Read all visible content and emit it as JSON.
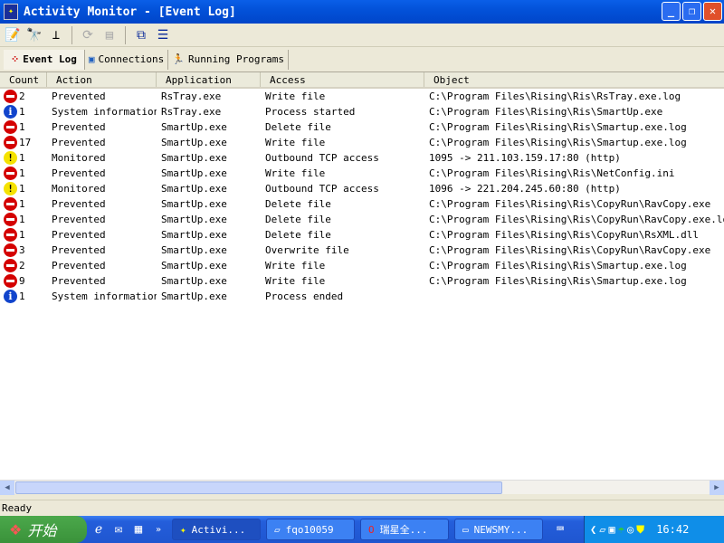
{
  "window": {
    "title": "Activity Monitor - [Event Log]"
  },
  "toolbar": [
    "properties-icon",
    "find-icon",
    "network-icon",
    "refresh-icon",
    "settings-icon",
    "cascade-icon",
    "tile-icon"
  ],
  "tabs": [
    {
      "label": "Event Log"
    },
    {
      "label": "Connections"
    },
    {
      "label": "Running Programs"
    }
  ],
  "columns": [
    "Count",
    "Action",
    "Application",
    "Access",
    "Object"
  ],
  "rows": [
    {
      "icon": "prevented",
      "count": "2",
      "action": "Prevented",
      "application": "RsTray.exe",
      "access": "Write file",
      "object": "C:\\Program Files\\Rising\\Ris\\RsTray.exe.log"
    },
    {
      "icon": "info",
      "count": "1",
      "action": "System information",
      "application": "RsTray.exe",
      "access": "Process started",
      "object": "C:\\Program Files\\Rising\\Ris\\SmartUp.exe"
    },
    {
      "icon": "prevented",
      "count": "1",
      "action": "Prevented",
      "application": "SmartUp.exe",
      "access": "Delete file",
      "object": "C:\\Program Files\\Rising\\Ris\\Smartup.exe.log"
    },
    {
      "icon": "prevented",
      "count": "17",
      "action": "Prevented",
      "application": "SmartUp.exe",
      "access": "Write file",
      "object": "C:\\Program Files\\Rising\\Ris\\Smartup.exe.log"
    },
    {
      "icon": "monitor",
      "count": "1",
      "action": "Monitored",
      "application": "SmartUp.exe",
      "access": "Outbound TCP access",
      "object": "1095 -> 211.103.159.17:80 (http)"
    },
    {
      "icon": "prevented",
      "count": "1",
      "action": "Prevented",
      "application": "SmartUp.exe",
      "access": "Write file",
      "object": "C:\\Program Files\\Rising\\Ris\\NetConfig.ini"
    },
    {
      "icon": "monitor",
      "count": "1",
      "action": "Monitored",
      "application": "SmartUp.exe",
      "access": "Outbound TCP access",
      "object": "1096 -> 221.204.245.60:80 (http)"
    },
    {
      "icon": "prevented",
      "count": "1",
      "action": "Prevented",
      "application": "SmartUp.exe",
      "access": "Delete file",
      "object": "C:\\Program Files\\Rising\\Ris\\CopyRun\\RavCopy.exe"
    },
    {
      "icon": "prevented",
      "count": "1",
      "action": "Prevented",
      "application": "SmartUp.exe",
      "access": "Delete file",
      "object": "C:\\Program Files\\Rising\\Ris\\CopyRun\\RavCopy.exe.log"
    },
    {
      "icon": "prevented",
      "count": "1",
      "action": "Prevented",
      "application": "SmartUp.exe",
      "access": "Delete file",
      "object": "C:\\Program Files\\Rising\\Ris\\CopyRun\\RsXML.dll"
    },
    {
      "icon": "prevented",
      "count": "3",
      "action": "Prevented",
      "application": "SmartUp.exe",
      "access": "Overwrite file",
      "object": "C:\\Program Files\\Rising\\Ris\\CopyRun\\RavCopy.exe"
    },
    {
      "icon": "prevented",
      "count": "2",
      "action": "Prevented",
      "application": "SmartUp.exe",
      "access": "Write file",
      "object": "C:\\Program Files\\Rising\\Ris\\Smartup.exe.log"
    },
    {
      "icon": "prevented",
      "count": "9",
      "action": "Prevented",
      "application": "SmartUp.exe",
      "access": "Write file",
      "object": "C:\\Program Files\\Rising\\Ris\\Smartup.exe.log"
    },
    {
      "icon": "info",
      "count": "1",
      "action": "System information",
      "application": "SmartUp.exe",
      "access": "Process ended",
      "object": ""
    }
  ],
  "status": "Ready",
  "taskbar": {
    "start": "开始",
    "tasks": [
      "Activi...",
      "fqo10059",
      "瑞星全...",
      "NEWSMY..."
    ],
    "clock": "16:42"
  }
}
